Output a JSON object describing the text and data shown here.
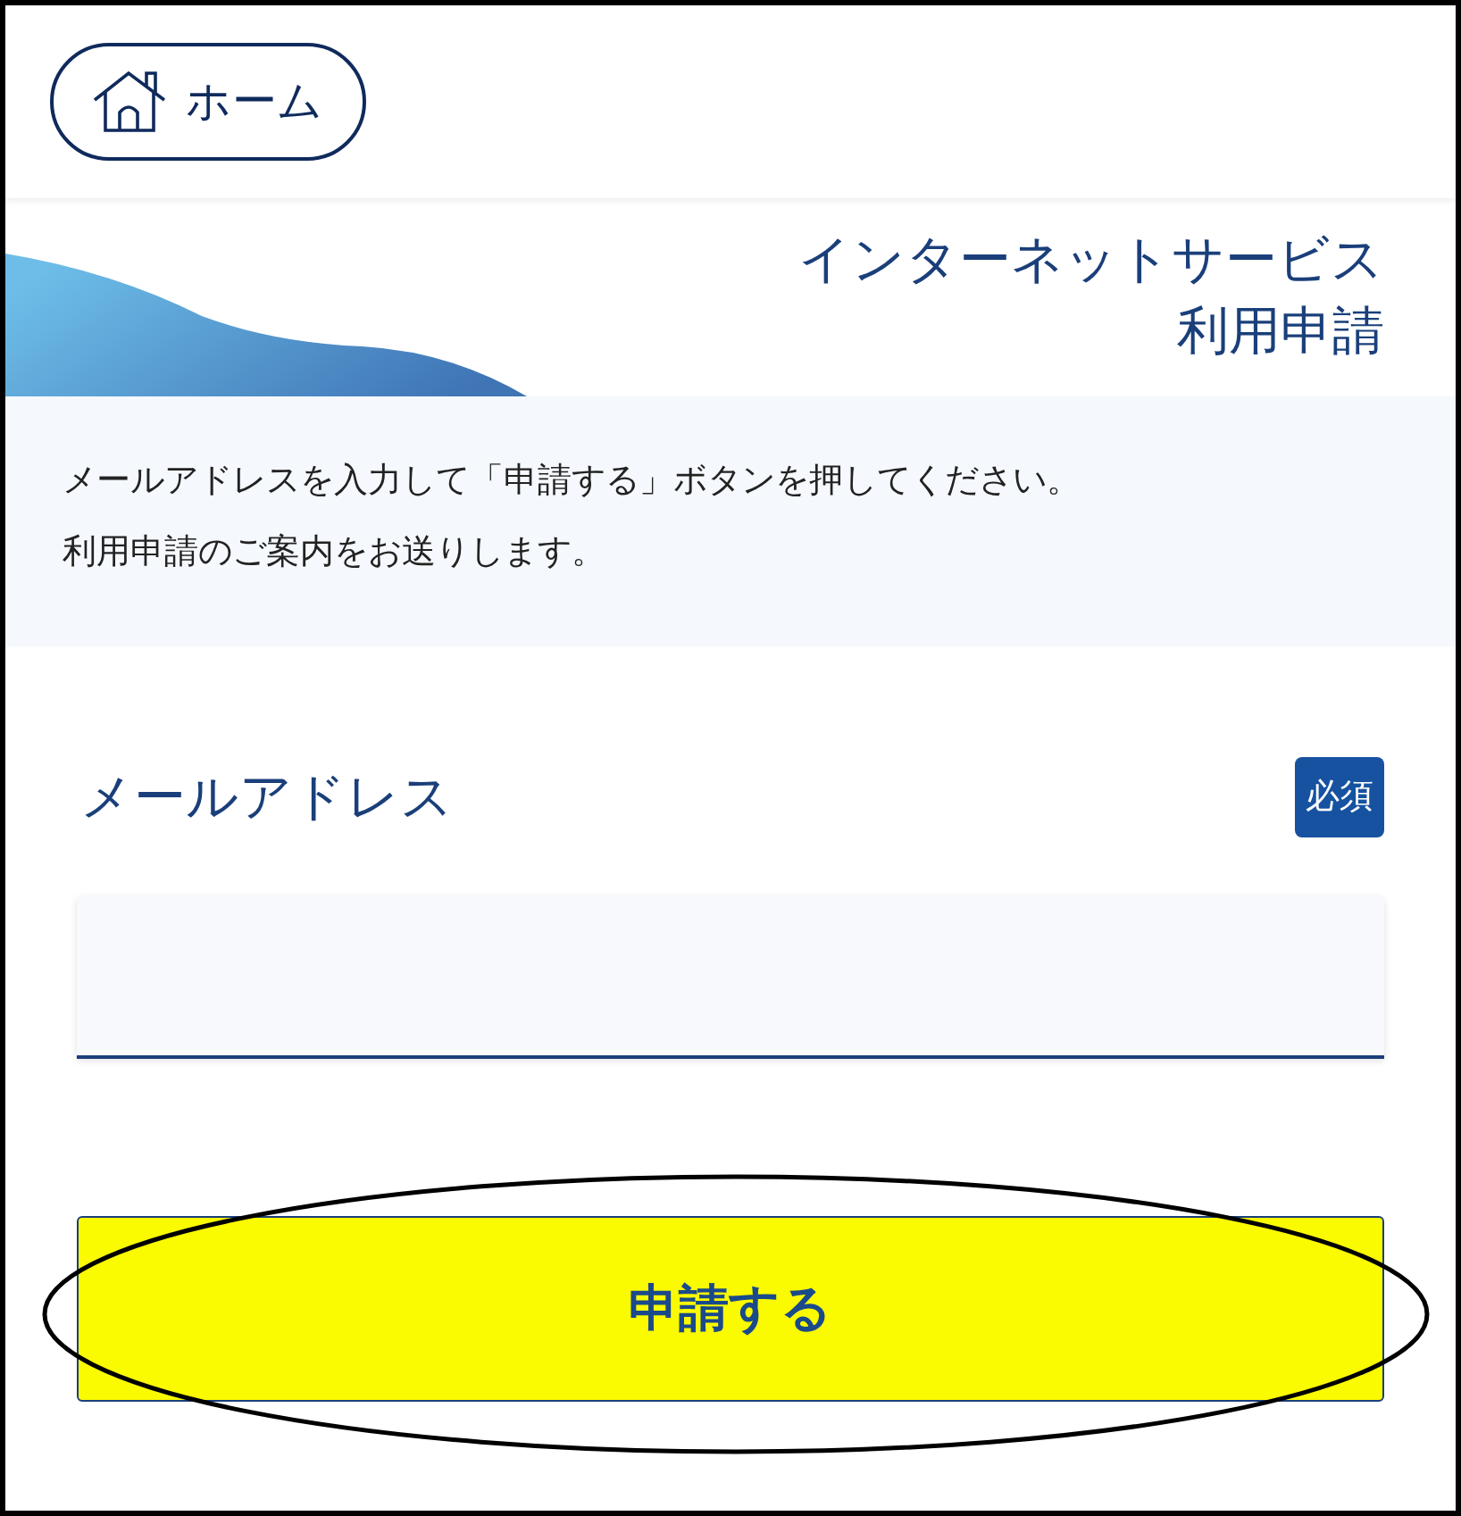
{
  "home_button": {
    "label": "ホーム"
  },
  "banner": {
    "title_lines": [
      "インターネットサービス",
      "利用申請"
    ]
  },
  "instructions": [
    "メールアドレスを入力して「申請する」ボタンを押してください。",
    "利用申請のご案内をお送りします。"
  ],
  "email_field": {
    "label": "メールアドレス",
    "required_badge": "必須"
  },
  "submit_button": {
    "label": "申請する",
    "highlighted": true
  }
}
